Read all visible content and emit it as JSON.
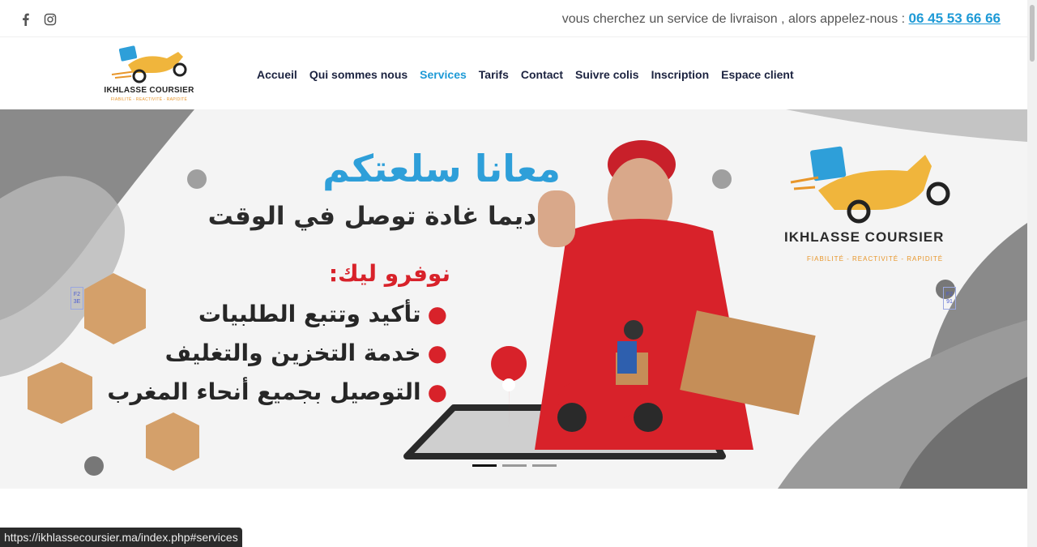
{
  "topbar": {
    "message": "vous cherchez un service de livraison , alors appelez-nous : ",
    "phone": "06 45 53 66 66",
    "social": [
      {
        "icon": "facebook-icon"
      },
      {
        "icon": "instagram-icon"
      }
    ]
  },
  "logo": {
    "name": "IKHLASSE COURSIER",
    "tagline": "FIABILITÉ - REACTIVITÉ - RAPIDITÉ"
  },
  "nav": [
    {
      "label": "Accueil",
      "active": false
    },
    {
      "label": "Qui sommes nous",
      "active": false
    },
    {
      "label": "Services",
      "active": true
    },
    {
      "label": "Tarifs",
      "active": false
    },
    {
      "label": "Contact",
      "active": false
    },
    {
      "label": "Suivre colis",
      "active": false
    },
    {
      "label": "Inscription",
      "active": false
    },
    {
      "label": "Espace client",
      "active": false
    }
  ],
  "hero": {
    "title": "معانا سلعتكم",
    "subtitle": "ديما غادة توصل في الوقت",
    "offer_heading": "نوفرو ليك:",
    "items": [
      "تأكيد وتتبع الطلبيات",
      "خدمة التخزين والتغليف",
      "التوصيل بجميع أنحاء المغرب"
    ],
    "logo_name": "IKHLASSE COURSIER",
    "logo_tagline": "FIABILITÉ - REACTIVITÉ - RAPIDITÉ",
    "prev_glyph": "F2 3E",
    "next_glyph": "F2 91",
    "slides": 3,
    "active_slide": 1
  },
  "status_url": "https://ikhlassecoursier.ma/index.php#services",
  "colors": {
    "accent": "#1e9ad6",
    "nav_text": "#1c2340",
    "hero_red": "#d8222a",
    "logo_orange": "#e8962a"
  }
}
